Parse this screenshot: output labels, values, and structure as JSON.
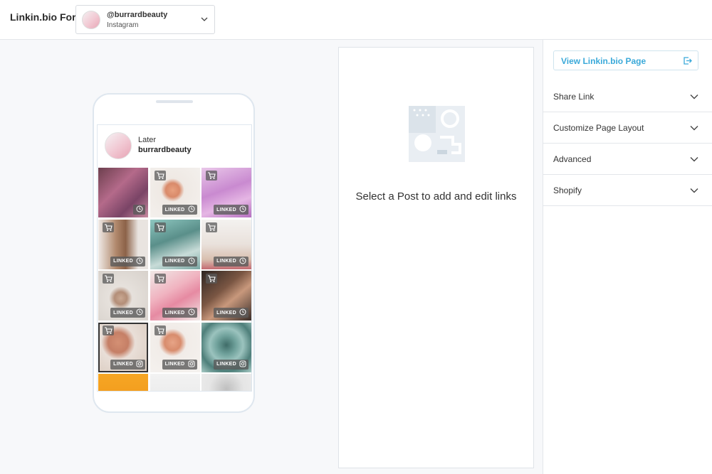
{
  "header": {
    "brand": "Linkin.bio For",
    "account_handle": "@burrardbeauty",
    "account_network": "Instagram"
  },
  "preview": {
    "profile_title": "Later",
    "profile_handle": "burrardbeauty",
    "posts": [
      {
        "cart": false,
        "badge": "",
        "status": "scheduled-clock",
        "bg": "linear-gradient(135deg,#6d3f4e,#b46a8a 40%,#7a4466 70%,#c78aa0)"
      },
      {
        "cart": true,
        "badge": "LINKED",
        "status": "scheduled-clock",
        "bg": "radial-gradient(circle at 45% 45%,#e8a07e 0,#d98a6a 18%,#efe9e4 30%,#f4f1ee 100%)"
      },
      {
        "cart": true,
        "badge": "LINKED",
        "status": "scheduled-clock",
        "bg": "linear-gradient(160deg,#e9c7e9,#c98ad0 45%,#e5b6e4 70%,#b56ec0)"
      },
      {
        "cart": true,
        "badge": "LINKED",
        "status": "scheduled-clock",
        "bg": "linear-gradient(90deg,#efeae6 0,#b28a6e 35%,#8c6248 55%,#e9e4e0 80%)"
      },
      {
        "cart": true,
        "badge": "LINKED",
        "status": "scheduled-clock",
        "bg": "linear-gradient(160deg,#8ec7c0,#5a8f8a 40%,#c8dcd8 70%,#7aa7a3)"
      },
      {
        "cart": true,
        "badge": "LINKED",
        "status": "scheduled-clock",
        "bg": "linear-gradient(180deg,#f4f2f0,#e9e1db 50%,#d9c0b0 80%,#c46a72)"
      },
      {
        "cart": true,
        "badge": "LINKED",
        "status": "scheduled-clock",
        "bg": "radial-gradient(circle at 45% 55%,#c9a892 0,#b38e78 16%,#e6e1dc 30%,#d7d1cb 100%)"
      },
      {
        "cart": true,
        "badge": "LINKED",
        "status": "scheduled-clock",
        "bg": "linear-gradient(150deg,#f1e9e7,#f0b3c0 40%,#e68aa2 60%,#f1e9e7)"
      },
      {
        "cart": true,
        "badge": "LINKED",
        "status": "scheduled-clock",
        "bg": "linear-gradient(140deg,#2d2522,#7a5643 40%,#c8987c 60%,#3a2e29)"
      },
      {
        "cart": true,
        "badge": "LINKED",
        "status": "instagram",
        "bg": "radial-gradient(circle at 40% 40%,#d49074 0,#c57f66 24%,#e9dfd8 40%,#d8c9bd 100%)",
        "selected": true
      },
      {
        "cart": true,
        "badge": "LINKED",
        "status": "instagram",
        "bg": "radial-gradient(circle at 45% 40%,#e7a487 0,#d88c6d 20%,#f1ece8 34%,#f5f2ef 100%)"
      },
      {
        "cart": false,
        "badge": "LINKED",
        "status": "instagram",
        "bg": "radial-gradient(circle at 50% 45%,#3f6c68 0,#6fa19b 25%,#9bc3be 45%,#4e7f7a 70%,#a9cbc6)"
      },
      {
        "cart": false,
        "badge": "",
        "status": "",
        "bg": "linear-gradient(180deg,#f6a623,#f29a1d 60%,#f05a8a)"
      },
      {
        "cart": false,
        "badge": "",
        "status": "",
        "bg": "linear-gradient(180deg,#f2f2f2,#e6e6e6)"
      },
      {
        "cart": false,
        "badge": "",
        "status": "",
        "bg": "radial-gradient(circle at 50% 30%,#bfbfbf 0,#e5e5e5 40%,#f0f0f0 100%)"
      }
    ]
  },
  "editor": {
    "empty_message": "Select a Post to add and edit links"
  },
  "sidebar": {
    "view_button": "View Linkin.bio Page",
    "sections": [
      {
        "label": "Share Link"
      },
      {
        "label": "Customize Page Layout"
      },
      {
        "label": "Advanced"
      },
      {
        "label": "Shopify"
      }
    ]
  },
  "colors": {
    "accent": "#3aa9d9",
    "border": "#e3e6ea",
    "canvas": "#f7f8fa"
  }
}
